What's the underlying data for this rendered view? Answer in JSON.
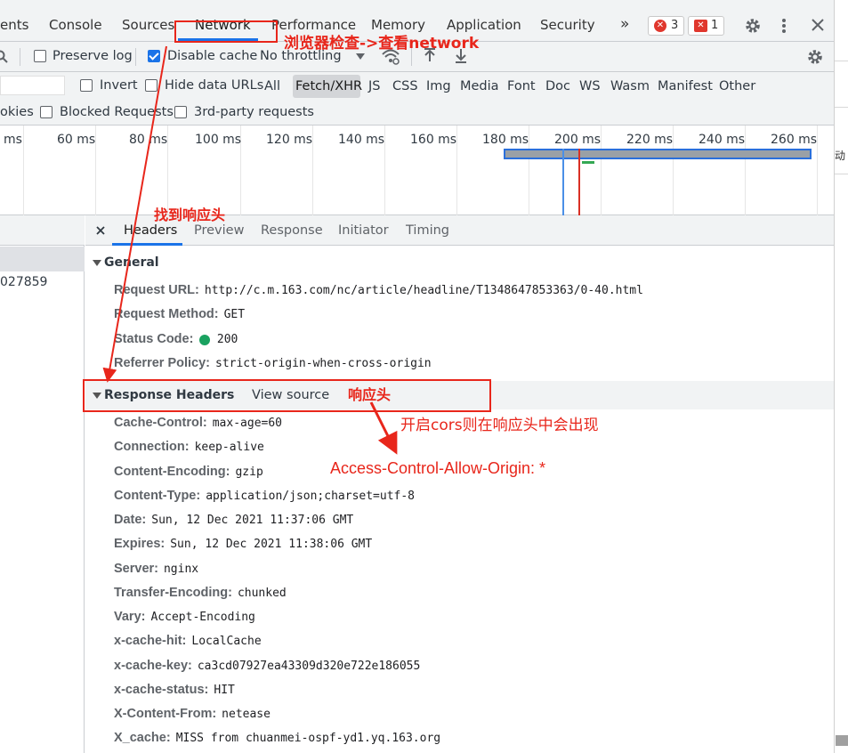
{
  "tabs": {
    "items": [
      "ents",
      "Console",
      "Sources",
      "Network",
      "Performance",
      "Memory",
      "Application",
      "Security"
    ],
    "more": "»",
    "errors_count": "3",
    "issues_count": "1"
  },
  "toolbar": {
    "preserve_log": "Preserve log",
    "disable_cache": "Disable cache",
    "throttling": "No throttling"
  },
  "filters": {
    "invert": "Invert",
    "hide_data_urls": "Hide data URLs",
    "types": [
      "All",
      "Fetch/XHR",
      "JS",
      "CSS",
      "Img",
      "Media",
      "Font",
      "Doc",
      "WS",
      "Wasm",
      "Manifest",
      "Other"
    ],
    "cookies_partial": "okies",
    "blocked_requests": "Blocked Requests",
    "third_party": "3rd-party requests"
  },
  "timeline": {
    "ticks": [
      "ms",
      "60 ms",
      "80 ms",
      "100 ms",
      "120 ms",
      "140 ms",
      "160 ms",
      "180 ms",
      "200 ms",
      "220 ms",
      "240 ms",
      "260 ms"
    ]
  },
  "request_list": {
    "selected_partial": "027859"
  },
  "details": {
    "tabs": [
      "Headers",
      "Preview",
      "Response",
      "Initiator",
      "Timing"
    ],
    "general": {
      "title": "General",
      "rows": [
        {
          "k": "Request URL:",
          "v": "http://c.m.163.com/nc/article/headline/T1348647853363/0-40.html"
        },
        {
          "k": "Request Method:",
          "v": "GET"
        },
        {
          "k": "Status Code:",
          "v": "200"
        },
        {
          "k": "Referrer Policy:",
          "v": "strict-origin-when-cross-origin"
        }
      ]
    },
    "response_headers": {
      "title": "Response Headers",
      "view_source": "View source",
      "rows": [
        {
          "k": "Cache-Control:",
          "v": "max-age=60"
        },
        {
          "k": "Connection:",
          "v": "keep-alive"
        },
        {
          "k": "Content-Encoding:",
          "v": "gzip"
        },
        {
          "k": "Content-Type:",
          "v": "application/json;charset=utf-8"
        },
        {
          "k": "Date:",
          "v": "Sun, 12 Dec 2021 11:37:06 GMT"
        },
        {
          "k": "Expires:",
          "v": "Sun, 12 Dec 2021 11:38:06 GMT"
        },
        {
          "k": "Server:",
          "v": "nginx"
        },
        {
          "k": "Transfer-Encoding:",
          "v": "chunked"
        },
        {
          "k": "Vary:",
          "v": "Accept-Encoding"
        },
        {
          "k": "x-cache-hit:",
          "v": "LocalCache"
        },
        {
          "k": "x-cache-key:",
          "v": "ca3cd07927ea43309d320e722e186055"
        },
        {
          "k": "x-cache-status:",
          "v": "HIT"
        },
        {
          "k": "X-Content-From:",
          "v": "netease"
        },
        {
          "k": "X_cache:",
          "v": "MISS from chuanmei-ospf-yd1.yq.163.org"
        }
      ]
    }
  },
  "annotations": {
    "network_note": "浏览器检查->查看network",
    "find_header": "找到响应头",
    "response_header": "响应头",
    "cors_note": "开启cors则在响应头中会出现",
    "acao": "Access-Control-Allow-Origin: *"
  },
  "right_strip_text": "动"
}
